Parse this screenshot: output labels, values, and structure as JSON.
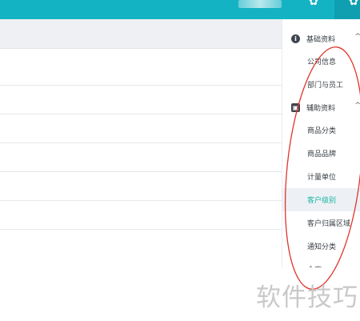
{
  "sidebar": {
    "groups": [
      {
        "label": "基础资料",
        "icon": "info-icon",
        "items": [
          {
            "label": "公司信息"
          },
          {
            "label": "部门与员工"
          }
        ]
      },
      {
        "label": "辅助资料",
        "icon": "box-icon",
        "items": [
          {
            "label": "商品分类"
          },
          {
            "label": "商品品牌"
          },
          {
            "label": "计量单位"
          },
          {
            "label": "客户级别",
            "active": true
          },
          {
            "label": "客户归属区域"
          },
          {
            "label": "通知分类"
          },
          {
            "label": "仓库"
          }
        ]
      }
    ]
  },
  "watermark": "软件技巧",
  "colors": {
    "topbar": "#14b3c4",
    "active_text": "#19b3a0",
    "active_bg": "#edf1f6",
    "annotation": "#e0352b"
  }
}
